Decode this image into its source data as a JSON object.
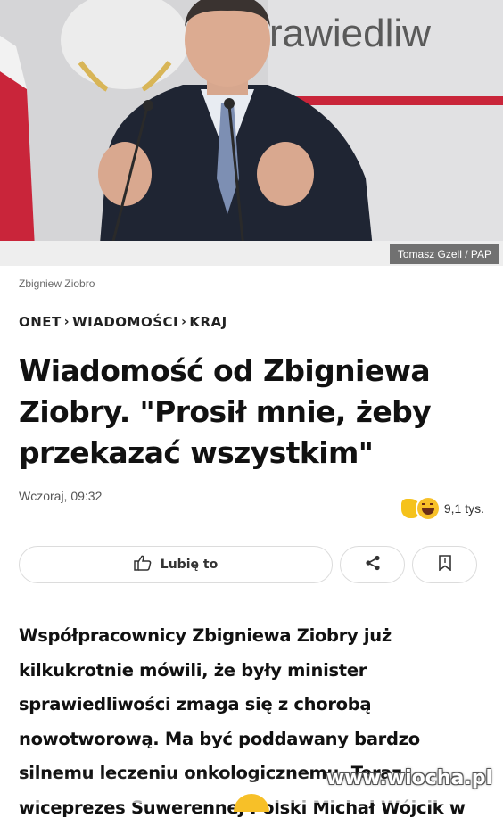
{
  "hero": {
    "wall_text": "rawiedliw",
    "credit": "Tomasz Gzell / PAP"
  },
  "caption": "Zbigniew Ziobro",
  "breadcrumb": {
    "items": [
      "ONET",
      "WIADOMOŚCI",
      "KRAJ"
    ],
    "separator": "›"
  },
  "article": {
    "title": "Wiadomość od Zbigniewa Ziobry. \"Prosił mnie, żeby przekazać wszystkim\"",
    "date": "Wczoraj, 09:32",
    "reactions_count": "9,1 tys.",
    "body": "Współpracownicy Zbigniewa Ziobry już kilkukrotnie mówili, że były minister sprawiedliwości zmaga się z chorobą nowotworową. Ma być poddawany bardzo silnemu leczeniu onkologicznemu. Teraz wiceprezes Suwerennej Polski Michał Wójcik w"
  },
  "actions": {
    "like_label": "Lubię to"
  },
  "icons": {
    "like": "thumbs-up-icon",
    "share": "share-icon",
    "bookmark": "bookmark-icon",
    "reaction1": "thumbs-up-emoji-icon",
    "reaction2": "laughing-emoji-icon"
  },
  "watermark": "www.wiocha.pl",
  "colors": {
    "flag_red": "#d4213d",
    "text": "#111111",
    "border": "#dcdcdc"
  }
}
